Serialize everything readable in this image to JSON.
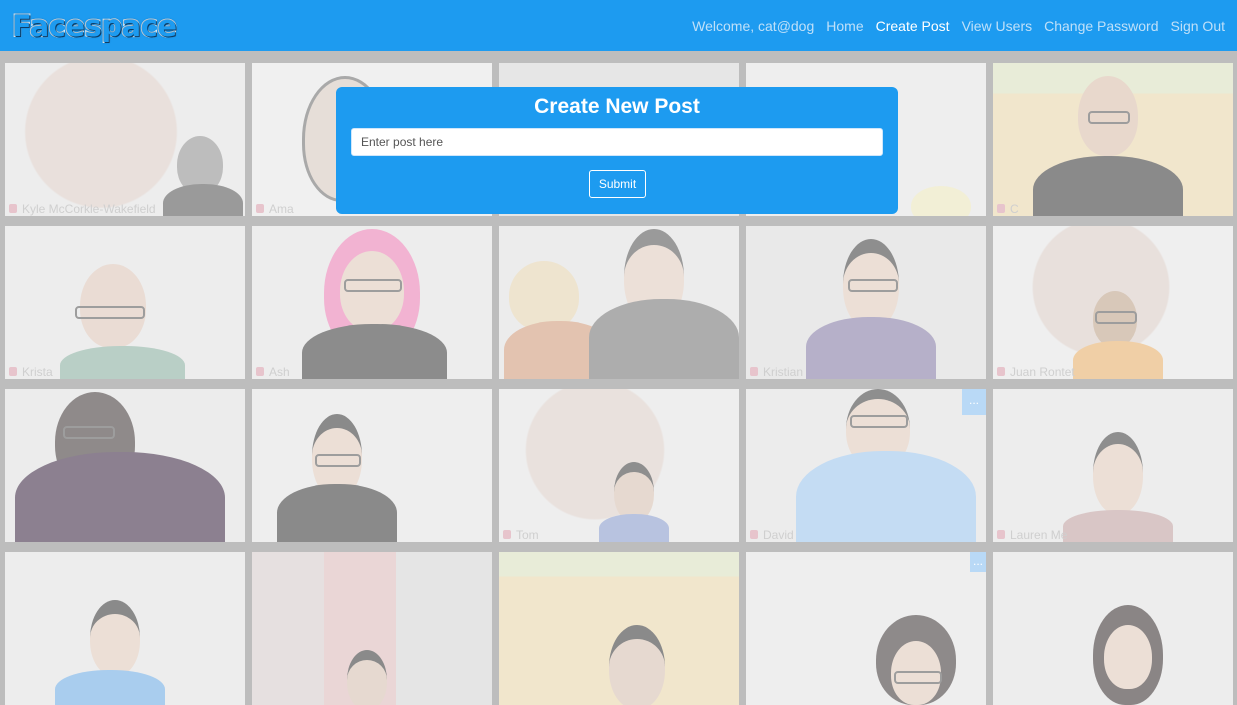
{
  "navbar": {
    "logo": "Facespace",
    "welcome": "Welcome, cat@dog",
    "links": [
      "Home",
      "Create Post",
      "View Users",
      "Change Password",
      "Sign Out"
    ],
    "active_link": "Create Post",
    "color": "#1d9bf0"
  },
  "modal": {
    "title": "Create New Post",
    "input_placeholder": "Enter post here",
    "input_value": "",
    "submit_label": "Submit"
  },
  "tiles": [
    {
      "name": "Kyle McCorkle-Wakefield"
    },
    {
      "name": "Ama"
    },
    {
      "name": ""
    },
    {
      "name": ""
    },
    {
      "name": "C"
    },
    {
      "name": "Krista"
    },
    {
      "name": "Ash"
    },
    {
      "name": ""
    },
    {
      "name": "Kristian"
    },
    {
      "name": "Juan Rontet"
    },
    {
      "name": ""
    },
    {
      "name": ""
    },
    {
      "name": "Tom"
    },
    {
      "name": "David"
    },
    {
      "name": "Lauren Me"
    },
    {
      "name": ""
    },
    {
      "name": ""
    },
    {
      "name": ""
    },
    {
      "name": ""
    },
    {
      "name": ""
    }
  ],
  "more_button_label": "..."
}
